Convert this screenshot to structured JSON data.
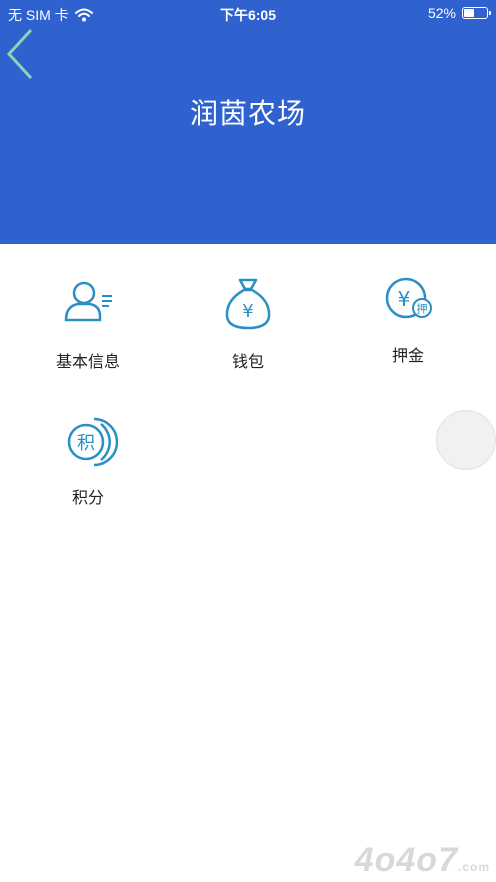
{
  "status_bar": {
    "carrier": "无 SIM 卡",
    "time": "下午6:05",
    "battery_percent": "52%",
    "battery_level": 0.52,
    "wifi_icon": "wifi-icon",
    "battery_icon": "battery-icon"
  },
  "header": {
    "title": "润茵农场",
    "back_icon": "chevron-left-icon",
    "background_color": "#2f62cf"
  },
  "menu": {
    "items": [
      {
        "label": "基本信息",
        "icon": "user-info-icon"
      },
      {
        "label": "钱包",
        "icon": "money-bag-icon"
      },
      {
        "label": "押金",
        "icon": "deposit-icon"
      },
      {
        "label": "积分",
        "icon": "points-icon"
      }
    ],
    "icon_color": "#2a8fc4"
  },
  "watermark": {
    "text": "4o4o7",
    "suffix": ".com"
  }
}
